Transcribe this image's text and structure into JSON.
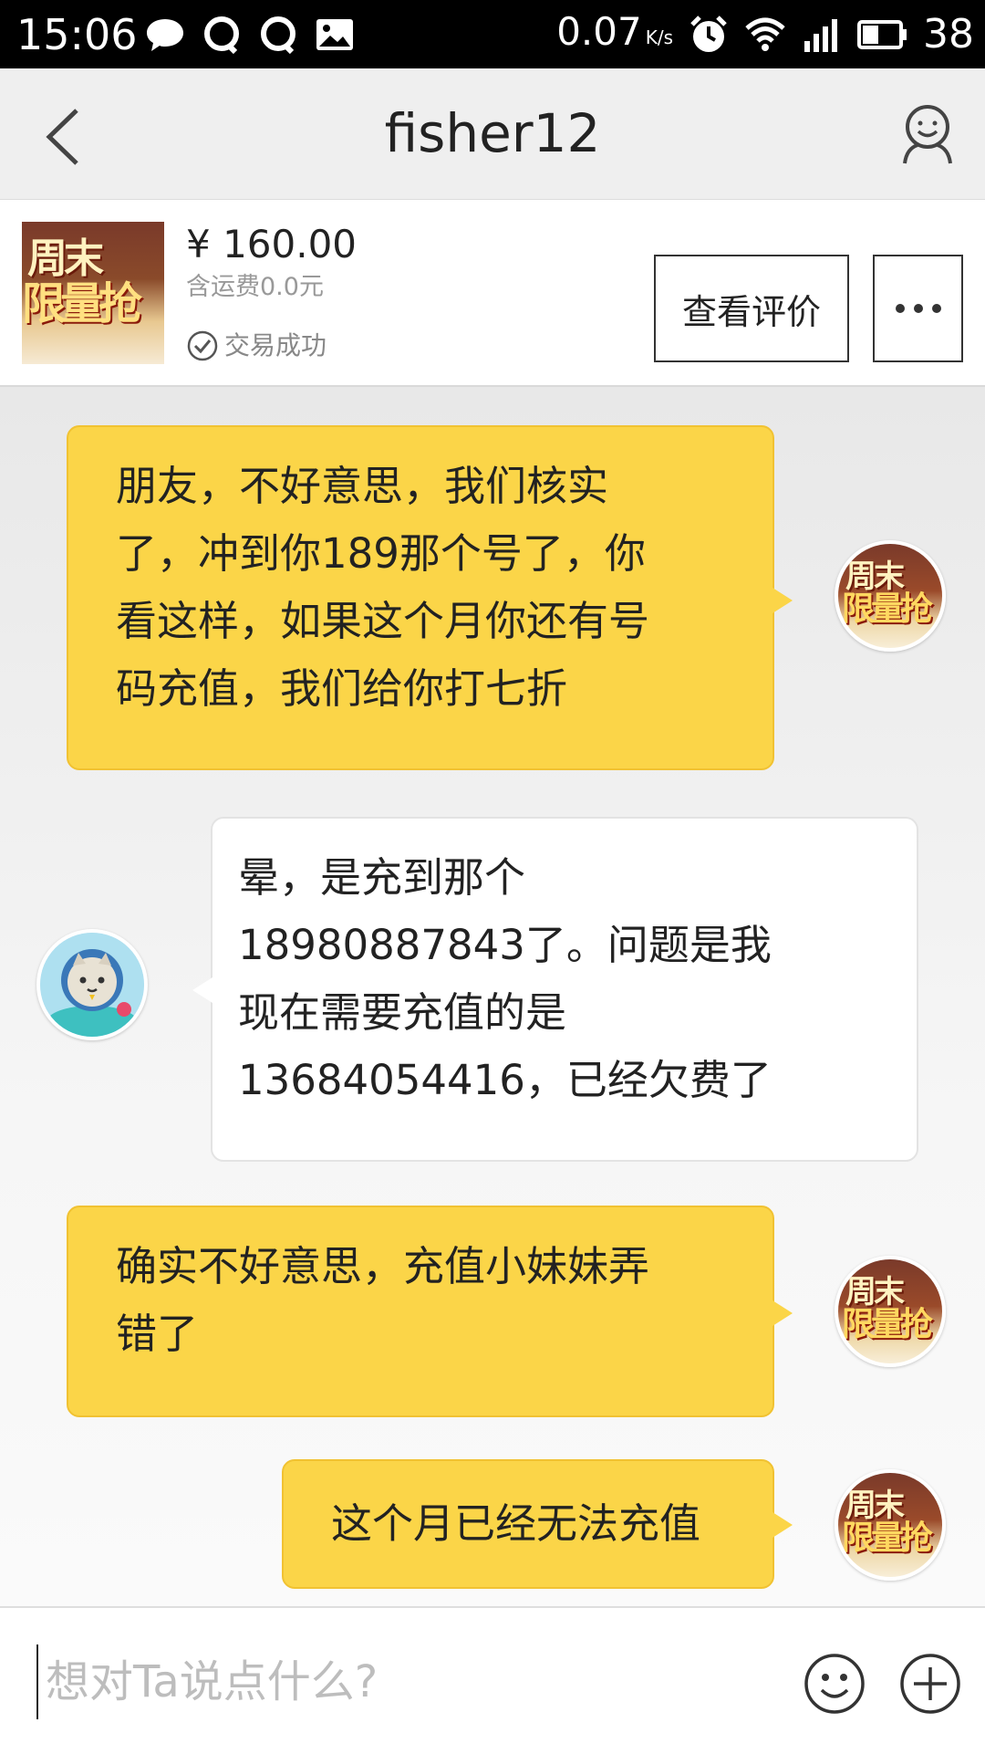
{
  "status_bar": {
    "time": "15:06",
    "speed": "0.07",
    "speed_unit": "K/s",
    "battery": "38",
    "left_icons": [
      "chat-bubble-icon",
      "qq-icon",
      "qq-icon",
      "image-icon"
    ],
    "right_icons": [
      "alarm-icon",
      "wifi-icon",
      "signal-3g-icon",
      "battery-icon"
    ]
  },
  "header": {
    "title": "fisher12"
  },
  "product": {
    "thumb_line1": "周末",
    "thumb_line2": "限量抢",
    "price": "¥ 160.00",
    "shipping": "含运费0.0元",
    "status": "交易成功",
    "review_button": "查看评价"
  },
  "messages": [
    {
      "side": "right",
      "lines": [
        "朋友，不好意思，我们核实",
        "了，冲到你189那个号了，你",
        "看这样，如果这个月你还有号",
        "码充值，我们给你打七折"
      ]
    },
    {
      "side": "left",
      "lines": [
        "晕，是充到那个",
        "18980887843了。问题是我",
        "现在需要充值的是",
        "13684054416，已经欠费了"
      ]
    },
    {
      "side": "right",
      "lines": [
        "确实不好意思，充值小妹妹弄",
        "错了"
      ]
    },
    {
      "side": "right",
      "lines": [
        "这个月已经无法充值"
      ]
    }
  ],
  "input": {
    "placeholder": "想对Ta说点什么?"
  },
  "colors": {
    "bubble_yellow": "#fbd548",
    "bubble_white": "#ffffff",
    "status_bar": "#000000"
  }
}
